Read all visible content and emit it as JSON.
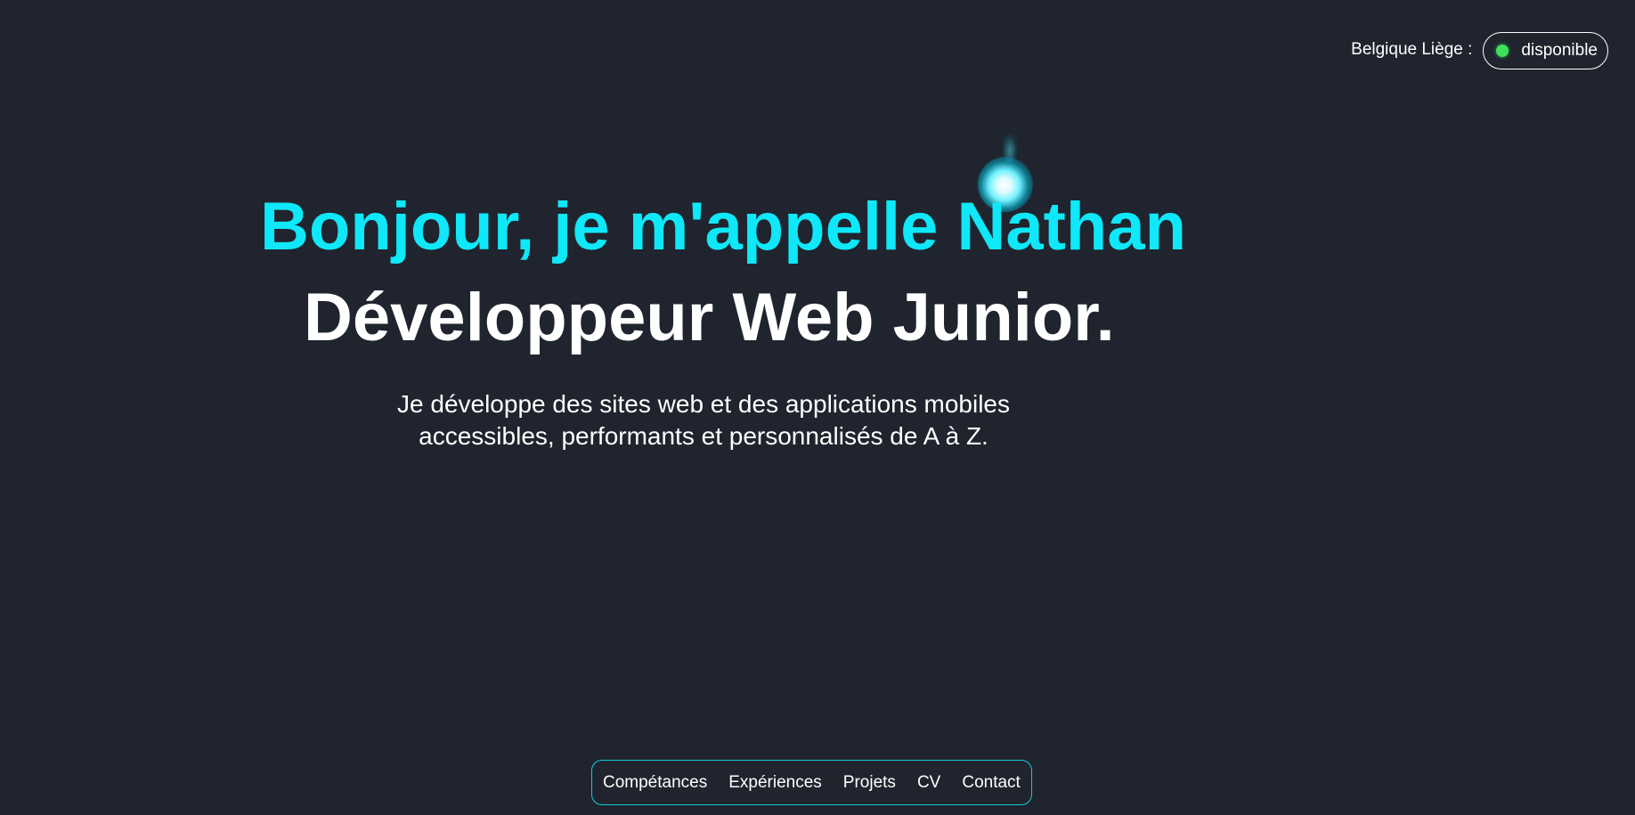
{
  "header": {
    "location_label": "Belgique Liège :",
    "status_text": "disponible",
    "status_color": "#3ee15a"
  },
  "hero": {
    "greeting": "Bonjour, je m'appelle Nathan",
    "role": "Développeur Web Junior.",
    "tagline": "Je développe des sites web et des applications mobiles accessibles, performants et personnalisés de A à Z.",
    "accent_color": "#0ee8f8"
  },
  "nav": {
    "items": [
      {
        "label": "Compétances"
      },
      {
        "label": "Expériences"
      },
      {
        "label": "Projets"
      },
      {
        "label": "CV"
      },
      {
        "label": "Contact"
      }
    ],
    "border_color": "#17c9d6"
  },
  "theme": {
    "background": "#20242e"
  }
}
